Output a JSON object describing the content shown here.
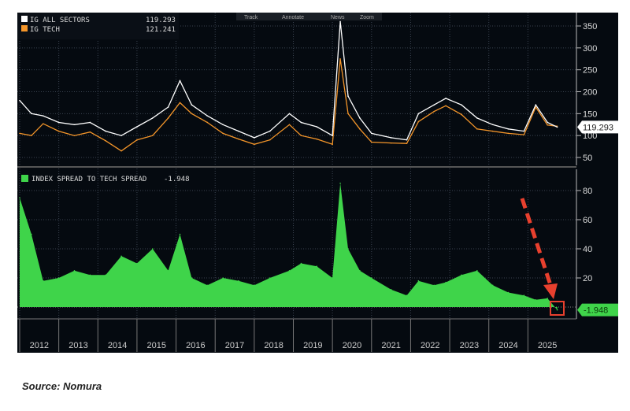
{
  "toolbar": {
    "track": "Track",
    "annotate": "Annotate",
    "news": "News",
    "zoom": "Zoom"
  },
  "source": "Source: Nomura",
  "colors": {
    "bg": "#050a10",
    "all": "#ffffff",
    "tech": "#f5962a",
    "spread": "#3fd44a",
    "arrow": "#e8402e"
  },
  "chart_data": [
    {
      "type": "line",
      "legend": [
        {
          "name": "IG ALL SECTORS",
          "value": "119.293"
        },
        {
          "name": "IG TECH",
          "value": "121.241"
        }
      ],
      "last_value_label": "119.293",
      "yticks": [
        50,
        100,
        150,
        200,
        250,
        300,
        350
      ],
      "ylim": [
        40,
        365
      ],
      "x": [
        2012.0,
        2012.3,
        2012.6,
        2013.0,
        2013.4,
        2013.8,
        2014.2,
        2014.6,
        2015.0,
        2015.4,
        2015.8,
        2016.1,
        2016.4,
        2016.8,
        2017.2,
        2017.6,
        2018.0,
        2018.4,
        2018.9,
        2019.2,
        2019.6,
        2020.0,
        2020.2,
        2020.4,
        2020.7,
        2021.0,
        2021.5,
        2021.9,
        2022.2,
        2022.6,
        2022.9,
        2023.3,
        2023.7,
        2024.1,
        2024.5,
        2024.9,
        2025.2,
        2025.5,
        2025.75
      ],
      "series": [
        {
          "name": "IG ALL SECTORS",
          "values": [
            180,
            150,
            145,
            130,
            125,
            130,
            110,
            100,
            120,
            140,
            165,
            225,
            170,
            145,
            125,
            110,
            95,
            110,
            150,
            130,
            120,
            100,
            360,
            190,
            140,
            105,
            95,
            90,
            150,
            170,
            185,
            170,
            140,
            125,
            115,
            110,
            170,
            130,
            119.293
          ]
        },
        {
          "name": "IG TECH",
          "values": [
            105,
            100,
            127,
            110,
            100,
            108,
            88,
            65,
            90,
            100,
            140,
            175,
            150,
            130,
            105,
            92,
            80,
            90,
            125,
            100,
            92,
            80,
            275,
            150,
            115,
            85,
            83,
            82,
            132,
            155,
            168,
            148,
            115,
            110,
            105,
            102,
            165,
            124,
            121.241
          ]
        }
      ]
    },
    {
      "type": "area",
      "legend": [
        {
          "name": "INDEX SPREAD TO TECH SPREAD",
          "value": "-1.948"
        }
      ],
      "last_value_label": "-1.948",
      "yticks": [
        20,
        40,
        60,
        80
      ],
      "ylim": [
        -8,
        92
      ],
      "x": [
        2012.0,
        2012.3,
        2012.6,
        2013.0,
        2013.4,
        2013.8,
        2014.2,
        2014.6,
        2015.0,
        2015.4,
        2015.8,
        2016.1,
        2016.4,
        2016.8,
        2017.2,
        2017.6,
        2018.0,
        2018.4,
        2018.9,
        2019.2,
        2019.6,
        2020.0,
        2020.2,
        2020.4,
        2020.7,
        2021.0,
        2021.5,
        2021.9,
        2022.2,
        2022.6,
        2022.9,
        2023.3,
        2023.7,
        2024.1,
        2024.5,
        2024.9,
        2025.2,
        2025.5,
        2025.75
      ],
      "values": [
        75,
        50,
        18,
        20,
        25,
        22,
        22,
        35,
        30,
        40,
        25,
        50,
        20,
        15,
        20,
        18,
        15,
        20,
        25,
        30,
        28,
        20,
        85,
        40,
        25,
        20,
        12,
        8,
        18,
        15,
        17,
        22,
        25,
        15,
        10,
        8,
        5,
        6,
        -1.948
      ]
    }
  ],
  "xaxis": {
    "years": [
      "2012",
      "2013",
      "2014",
      "2015",
      "2016",
      "2017",
      "2018",
      "2019",
      "2020",
      "2021",
      "2022",
      "2023",
      "2024",
      "2025"
    ]
  }
}
